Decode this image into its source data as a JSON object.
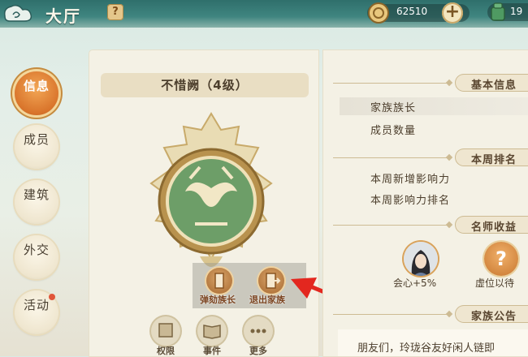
{
  "header": {
    "title": "大厅",
    "help_label": "?",
    "coins": "62510",
    "plus_label": "+",
    "stamina": "19"
  },
  "side_tabs": [
    {
      "label": "信息",
      "active": true
    },
    {
      "label": "成员"
    },
    {
      "label": "建筑"
    },
    {
      "label": "外交"
    },
    {
      "label": "活动"
    }
  ],
  "family": {
    "name": "不惜阙（4级）"
  },
  "popup_actions": {
    "impeach_label": "弹劾族长",
    "leave_label": "退出家族"
  },
  "bottom_actions": {
    "permission_label": "权限",
    "events_label": "事件",
    "more_label": "更多"
  },
  "sections": {
    "basic_info": "基本信息",
    "weekly_rank": "本周排名",
    "mentor_benefit": "名师收益",
    "announcement": "家族公告"
  },
  "basic_info": {
    "leader_label": "家族族长",
    "members_label": "成员数量"
  },
  "weekly": {
    "new_influence_label": "本周新增影响力",
    "influence_rank_label": "本周影响力排名"
  },
  "mentor": {
    "bonus_label": "会心+5%",
    "vacant_label": "虚位以待",
    "vacant_mark": "?"
  },
  "announcement_text": "朋友们，玲珑谷友好闲人链即",
  "colors": {
    "accent": "#d9742b",
    "panel": "#f4f1e5",
    "topbar": "#3f8580"
  }
}
